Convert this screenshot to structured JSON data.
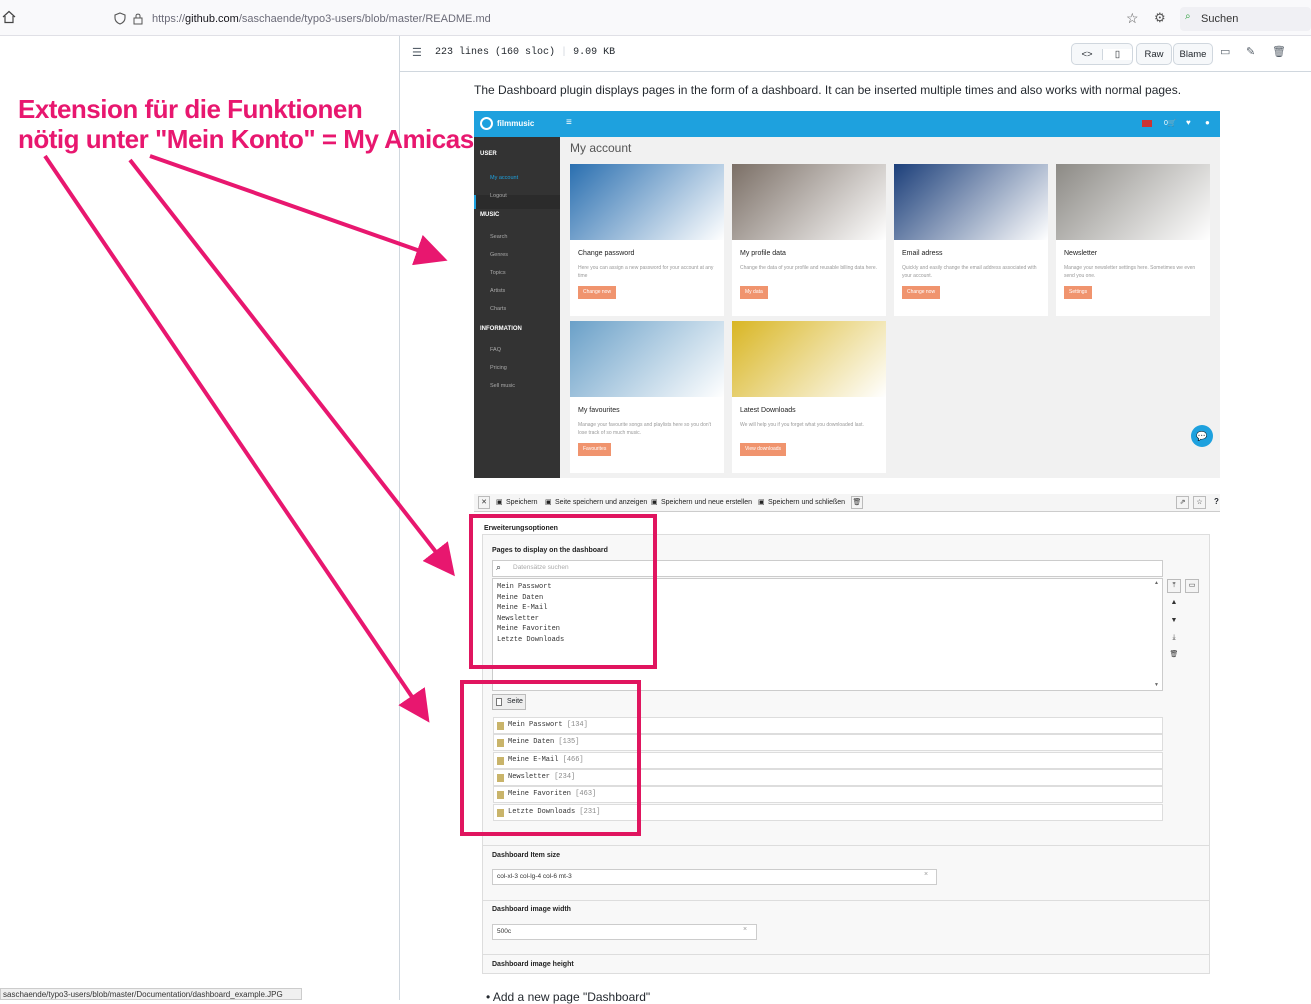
{
  "browser": {
    "url_prefix": "https://",
    "url_host": "github.com",
    "url_path": "/saschaende/typo3-users/blob/master/README.md",
    "search_label": "Suchen"
  },
  "file_header": {
    "lines_info": "223 lines (160 sloc)",
    "size_info": "9.09 KB",
    "raw_label": "Raw",
    "blame_label": "Blame"
  },
  "readme": {
    "intro": "The Dashboard plugin displays pages in the form of a dashboard. It can be inserted multiple times and also works with normal pages.",
    "bullet": "Add a new page \"Dashboard\""
  },
  "annotation": {
    "line1": "Extension für die Funktionen",
    "line2": "nötig unter \"Mein Konto\" = My Amicas"
  },
  "filmmusic": {
    "brand": "filmmusic",
    "cart_count": "0",
    "heading": "My account",
    "sidebar": [
      {
        "type": "section",
        "label": "USER"
      },
      {
        "type": "item",
        "label": "My account"
      },
      {
        "type": "item",
        "label": "Logout"
      },
      {
        "type": "section",
        "label": "MUSIC"
      },
      {
        "type": "item",
        "label": "Search"
      },
      {
        "type": "item",
        "label": "Genres"
      },
      {
        "type": "item",
        "label": "Topics"
      },
      {
        "type": "item",
        "label": "Artists"
      },
      {
        "type": "item",
        "label": "Charts"
      },
      {
        "type": "section",
        "label": "INFORMATION"
      },
      {
        "type": "item",
        "label": "FAQ"
      },
      {
        "type": "item",
        "label": "Pricing"
      },
      {
        "type": "item",
        "label": "Sell music"
      }
    ],
    "cards": [
      {
        "title": "Change password",
        "desc": "Here you can assign a new password for your account at any time",
        "button": "Change now",
        "img_color": "#2a6fb0"
      },
      {
        "title": "My profile data",
        "desc": "Change the data of your profile and reusable billing data here.",
        "button": "My data",
        "img_color": "#7b6f66"
      },
      {
        "title": "Email adress",
        "desc": "Quickly and easily change the email address associated with your account.",
        "button": "Change now",
        "img_color": "#1c3f7a"
      },
      {
        "title": "Newsletter",
        "desc": "Manage your newsletter settings here. Sometimes we even send you one.",
        "button": "Settings",
        "img_color": "#8c8a85"
      },
      {
        "title": "My favourites",
        "desc": "Manage your favourite songs and playlists here so you don't lose track of so much music.",
        "button": "Favourites",
        "img_color": "#6aa0c8"
      },
      {
        "title": "Latest Downloads",
        "desc": "We will help you if you forget what you downloaded last.",
        "button": "View downloads",
        "img_color": "#d9b624"
      }
    ]
  },
  "typo3": {
    "toolbar": [
      "Speichern",
      "Seite speichern und anzeigen",
      "Speichern und neue erstellen",
      "Speichern und schließen"
    ],
    "section_title": "Erweiterungsoptionen",
    "pages_label": "Pages to display on the dashboard",
    "search_placeholder": "Datensätze suchen",
    "selected_pages": [
      "Mein Passwort",
      "Meine Daten",
      "Meine E-Mail",
      "Newsletter",
      "Meine Favoriten",
      "Letzte Downloads"
    ],
    "seite_button": "Seite",
    "records": [
      {
        "name": "Mein Passwort",
        "id": "[134]"
      },
      {
        "name": "Meine Daten",
        "id": "[135]"
      },
      {
        "name": "Meine E-Mail",
        "id": "[466]"
      },
      {
        "name": "Newsletter",
        "id": "[234]"
      },
      {
        "name": "Meine Favoriten",
        "id": "[463]"
      },
      {
        "name": "Letzte Downloads",
        "id": "[231]"
      }
    ],
    "item_size_label": "Dashboard Item size",
    "item_size_value": "col-xl-3 col-lg-4 col-6 mt-3",
    "image_width_label": "Dashboard image width",
    "image_width_value": "500c",
    "image_height_label": "Dashboard image height"
  },
  "status_url": "saschaende/typo3-users/blob/master/Documentation/dashboard_example.JPG",
  "colors": {
    "accent": "#e8176f",
    "filmmusic_blue": "#1ea1de",
    "button_orange": "#f0946e"
  }
}
